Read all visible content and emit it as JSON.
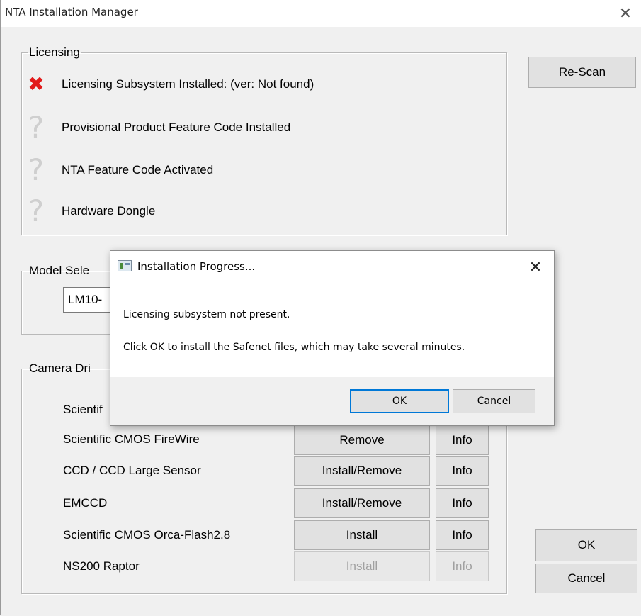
{
  "window": {
    "title": "NTA Installation Manager",
    "close_glyph": "✕"
  },
  "licensing": {
    "legend": "Licensing",
    "items": [
      {
        "status": "error",
        "icon": "x-mark-icon",
        "glyph": "✖",
        "label": "Licensing Subsystem Installed: (ver: Not found)"
      },
      {
        "status": "unknown",
        "icon": "question-icon",
        "glyph": "?",
        "label": "Provisional Product Feature Code Installed"
      },
      {
        "status": "unknown",
        "icon": "question-icon",
        "glyph": "?",
        "label": "NTA Feature Code Activated"
      },
      {
        "status": "unknown",
        "icon": "question-icon",
        "glyph": "?",
        "label": "Hardware Dongle"
      }
    ]
  },
  "rescan_label": "Re-Scan",
  "model": {
    "legend": "Model Sele",
    "selected": "LM10-"
  },
  "drivers": {
    "legend": "Camera Dri",
    "rows": [
      {
        "name": "Scientif",
        "action": "",
        "info": ""
      },
      {
        "name": "Scientific CMOS FireWire",
        "action": "Remove",
        "info": "Info",
        "disabled": false
      },
      {
        "name": "CCD / CCD Large Sensor",
        "action": "Install/Remove",
        "info": "Info",
        "disabled": false
      },
      {
        "name": "EMCCD",
        "action": "Install/Remove",
        "info": "Info",
        "disabled": false
      },
      {
        "name": "Scientific CMOS Orca-Flash2.8",
        "action": "Install",
        "info": "Info",
        "disabled": false
      },
      {
        "name": "NS200 Raptor",
        "action": "Install",
        "info": "Info",
        "disabled": true
      }
    ]
  },
  "ok_label": "OK",
  "cancel_label": "Cancel",
  "dialog": {
    "title": "Installation Progress...",
    "close_glyph": "✕",
    "line1": "Licensing subsystem not present.",
    "line2": "Click OK to install the Safenet files, which may take several minutes.",
    "ok_label": "OK",
    "cancel_label": "Cancel"
  },
  "colors": {
    "error": "#e21b1b",
    "unknown": "#cfcfcf",
    "accent": "#0078d7"
  }
}
